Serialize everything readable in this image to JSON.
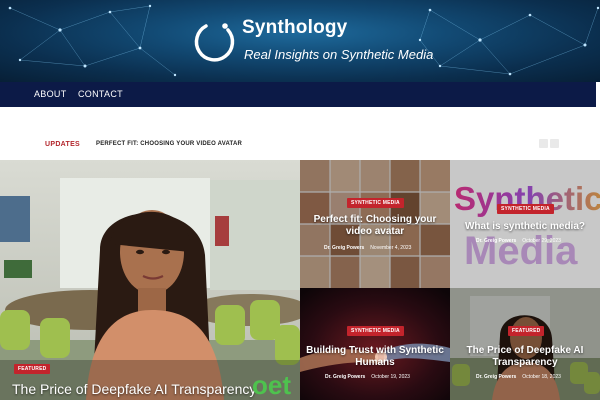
{
  "site": {
    "name": "Synthology",
    "tagline": "Real Insights on Synthetic Media"
  },
  "nav": {
    "items": [
      {
        "label": "ABOUT"
      },
      {
        "label": "CONTACT"
      }
    ]
  },
  "ticker": {
    "label": "UPDATES",
    "headline": "PERFECT FIT: CHOOSING YOUR VIDEO AVATAR"
  },
  "feature": {
    "badge": "FEATURED",
    "title": "The Price of Deepfake AI Transparency",
    "overlay_text": "oet"
  },
  "posts": [
    {
      "badge": "SYNTHETIC MEDIA",
      "title": "Perfect fit: Choosing your video avatar",
      "author": "Dr. Greig Powers",
      "date": "November 4, 2023"
    },
    {
      "badge": "SYNTHETIC MEDIA",
      "title": "What is synthetic media?",
      "author": "Dr. Greig Powers",
      "date": "October 29, 2023",
      "image_text_line1": "Synthetic",
      "image_text_line2": "Media"
    },
    {
      "badge": "SYNTHETIC MEDIA",
      "title": "Building Trust with Synthetic Humans",
      "author": "Dr. Greig Powers",
      "date": "October 19, 2023"
    },
    {
      "badge": "FEATURED",
      "title": "The Price of Deepfake AI Transparency",
      "author": "Dr. Greig Powers",
      "date": "October 18, 2023"
    }
  ],
  "colors": {
    "nav_bg": "#0c1a47",
    "badge_red": "#c3242c",
    "ticker_red": "#b3262c"
  }
}
